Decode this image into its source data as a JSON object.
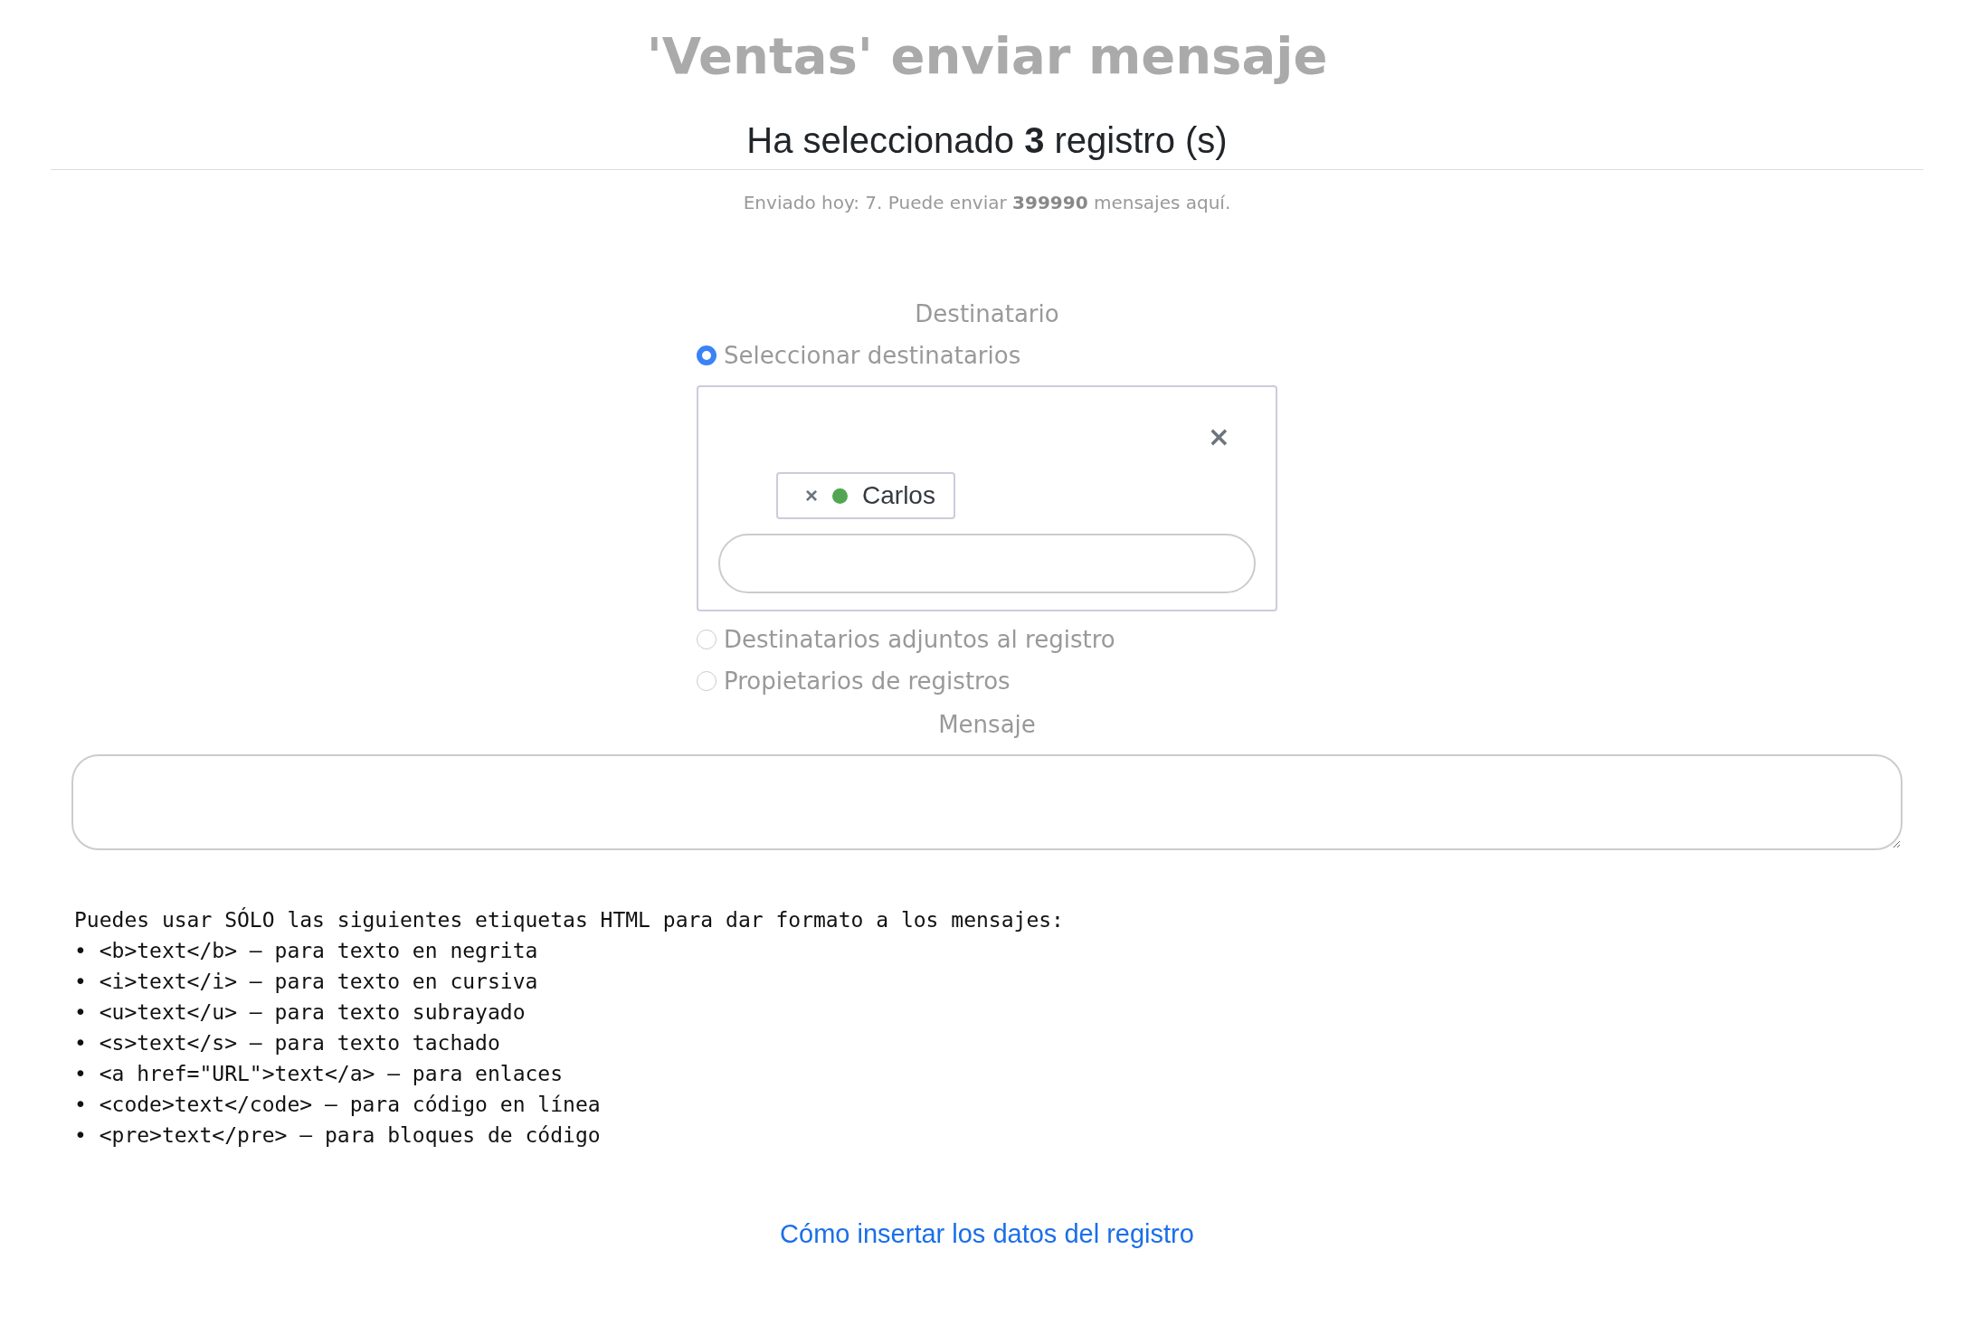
{
  "title": "'Ventas' enviar mensaje",
  "subtitle": "Ha seleccionado **3** registro (s)",
  "info": "Enviado hoy: 7. Puede enviar **399990** mensajes aquí.",
  "recipient": {
    "heading": "Destinatario",
    "options": [
      {
        "label": "Seleccionar destinatarios",
        "selected": true
      },
      {
        "label": "Destinatarios adjuntos al registro",
        "selected": false
      },
      {
        "label": "Propietarios de registros",
        "selected": false
      }
    ],
    "clear_icon": "×",
    "tags": [
      {
        "remove_icon": "×",
        "label": "Carlos",
        "color": "#52a552"
      }
    ]
  },
  "message": {
    "heading": "Mensaje"
  },
  "help": {
    "intro": "Puedes usar SÓLO las siguientes etiquetas HTML para dar formato a los mensajes:",
    "items": [
      "• <b>text</b> — para texto en negrita",
      "• <i>text</i> — para texto en cursiva",
      "• <u>text</u> — para texto subrayado",
      "• <s>text</s> — para texto tachado",
      "• <a href=\"URL\">text</a> — para enlaces",
      "• <code>text</code> — para código en línea",
      "• <pre>text</pre> — para bloques de código"
    ]
  },
  "link": "Cómo insertar los datos del registro"
}
